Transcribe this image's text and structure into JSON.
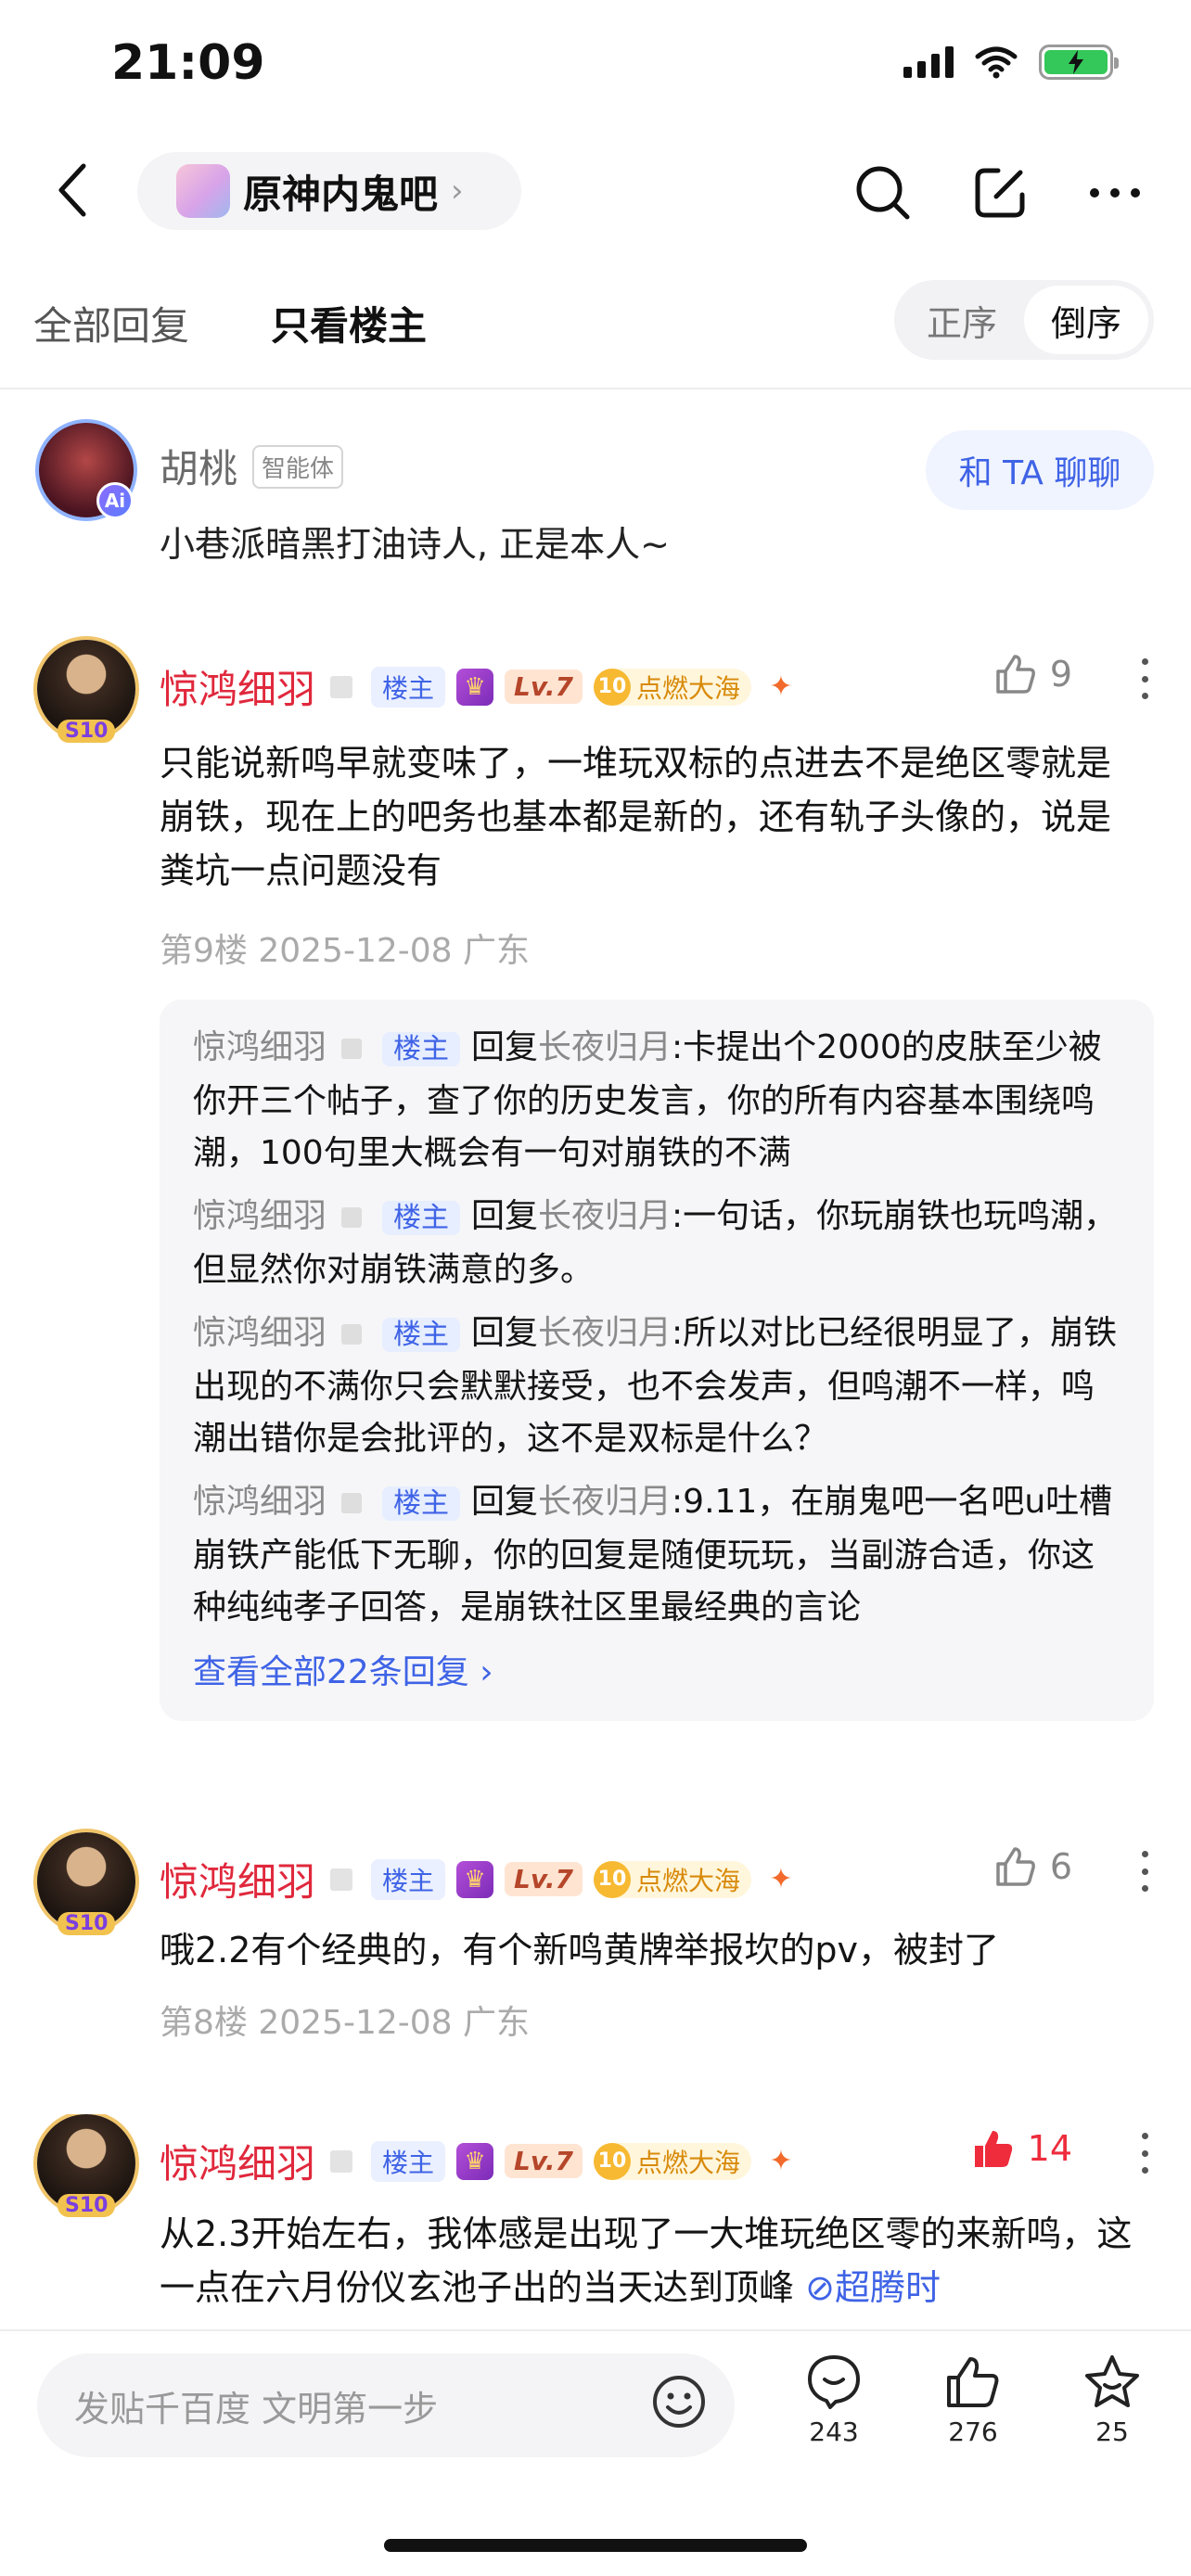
{
  "status": {
    "time": "21:09"
  },
  "nav": {
    "forum_name": "原神内鬼吧",
    "chevron": "›"
  },
  "filter": {
    "tabs": [
      "全部回复",
      "只看楼主"
    ],
    "order": [
      "正序",
      "倒序"
    ]
  },
  "ai_card": {
    "name": "胡桃",
    "tag": "智能体",
    "badge": "Ai",
    "desc": "小巷派暗黑打油诗人, 正是本人~",
    "chat_button": "和 TA 聊聊"
  },
  "common": {
    "louzhu": "楼主",
    "lv": "Lv.7",
    "fire_num": "10",
    "fire_label": "点燃大海",
    "avatar_badge": "S10",
    "reply_word": "回复"
  },
  "posts": [
    {
      "author": "惊鸿细羽",
      "likes": "9",
      "liked": false,
      "content": "只能说新鸣早就变味了，一堆玩双标的点进去不是绝区零就是崩铁，现在上的吧务也基本都是新的，还有轨子头像的，说是粪坑一点问题没有",
      "meta": "第9楼 2025-12-08 广东",
      "replies": [
        {
          "author": "惊鸿细羽",
          "target": "长夜归月",
          "text": ":卡提出个2000的皮肤至少被你开三个帖子，查了你的历史发言，你的所有内容基本围绕鸣潮，100句里大概会有一句对崩铁的不满"
        },
        {
          "author": "惊鸿细羽",
          "target": "长夜归月",
          "text": ":一句话，你玩崩铁也玩鸣潮，但显然你对崩铁满意的多。"
        },
        {
          "author": "惊鸿细羽",
          "target": "长夜归月",
          "text": ":所以对比已经很明显了，崩铁出现的不满你只会默默接受，也不会发声，但鸣潮不一样，鸣潮出错你是会批评的，这不是双标是什么？"
        },
        {
          "author": "惊鸿细羽",
          "target": "长夜归月",
          "text": ":9.11，在崩鬼吧一名吧u吐槽崩铁产能低下无聊，你的回复是随便玩玩，当副游合适，你这种纯纯孝子回答，是崩铁社区里最经典的言论"
        }
      ],
      "view_all": "查看全部22条回复 ›"
    },
    {
      "author": "惊鸿细羽",
      "likes": "6",
      "liked": false,
      "content": "哦2.2有个经典的，有个新鸣黄牌举报坎的pv，被封了",
      "meta": "第8楼 2025-12-08 广东"
    },
    {
      "author": "惊鸿细羽",
      "likes": "14",
      "liked": true,
      "content": "从2.3开始左右，我体感是出现了一大堆玩绝区零的来新鸣，这一点在六月份仪玄池子出的当天达到顶峰",
      "link": "超腾时"
    }
  ],
  "bottom": {
    "placeholder": "发贴千百度 文明第一步",
    "actions": [
      {
        "icon": "comment-icon",
        "count": "243"
      },
      {
        "icon": "like-icon",
        "count": "276"
      },
      {
        "icon": "star-icon",
        "count": "25"
      }
    ]
  },
  "colors": {
    "accent": "#3f63e6",
    "author": "#e0283c",
    "liked": "#ee2c3c"
  }
}
